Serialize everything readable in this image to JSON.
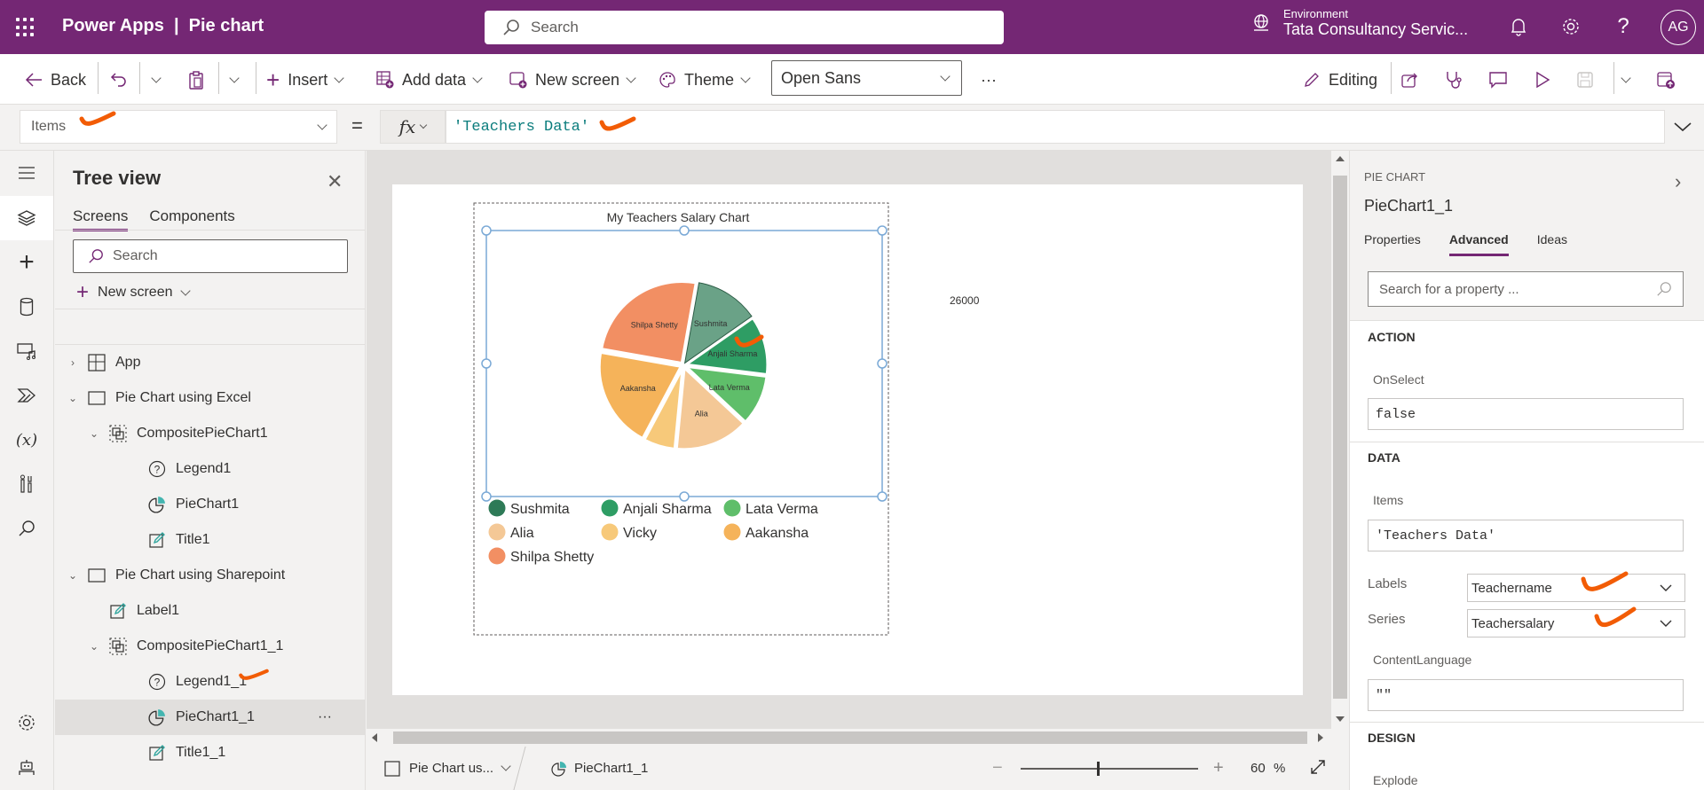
{
  "header": {
    "app_title": "Power Apps  |  Pie chart",
    "search_placeholder": "Search",
    "environment_label": "Environment",
    "environment_name": "Tata Consultancy Servic...",
    "avatar_initials": "AG"
  },
  "toolbar": {
    "back": "Back",
    "insert": "Insert",
    "add_data": "Add data",
    "new_screen": "New screen",
    "theme": "Theme",
    "font": "Open Sans",
    "more": "···",
    "editing": "Editing"
  },
  "formula_bar": {
    "property": "Items",
    "equals": "=",
    "fx": "fx",
    "formula": "'Teachers Data'"
  },
  "tree_view": {
    "title": "Tree view",
    "tabs": [
      "Screens",
      "Components"
    ],
    "search_placeholder": "Search",
    "new_screen": "New screen",
    "rows": [
      {
        "label": "App",
        "indent": 0,
        "icon": "app-icon",
        "arrow": "›"
      },
      {
        "label": "Pie Chart using Excel",
        "indent": 0,
        "icon": "screen-icon",
        "arrow": "⌄"
      },
      {
        "label": "CompositePieChart1",
        "indent": 1,
        "icon": "group-icon",
        "arrow": "⌄"
      },
      {
        "label": "Legend1",
        "indent": 2,
        "icon": "legend-icon",
        "arrow": ""
      },
      {
        "label": "PieChart1",
        "indent": 2,
        "icon": "piechart-icon",
        "arrow": ""
      },
      {
        "label": "Title1",
        "indent": 2,
        "icon": "label-icon",
        "arrow": ""
      },
      {
        "label": "Pie Chart using Sharepoint",
        "indent": 0,
        "icon": "screen-icon",
        "arrow": "⌄"
      },
      {
        "label": "Label1",
        "indent": 1,
        "icon": "label-icon",
        "arrow": ""
      },
      {
        "label": "CompositePieChart1_1",
        "indent": 1,
        "icon": "group-icon",
        "arrow": "⌄"
      },
      {
        "label": "Legend1_1",
        "indent": 2,
        "icon": "legend-icon",
        "arrow": ""
      },
      {
        "label": "PieChart1_1",
        "indent": 2,
        "icon": "piechart-icon",
        "arrow": "",
        "selected": true
      },
      {
        "label": "Title1_1",
        "indent": 2,
        "icon": "label-icon",
        "arrow": ""
      }
    ],
    "row_more": "···"
  },
  "canvas": {
    "floating_value": "26000"
  },
  "chart_data": {
    "type": "pie",
    "title": "My Teachers Salary Chart",
    "categories": [
      "Sushmita",
      "Anjali Sharma",
      "Lata Verma",
      "Alia",
      "Vicky",
      "Aakansha",
      "Shilpa Shetty"
    ],
    "values": [
      30000,
      28000,
      24000,
      35000,
      15000,
      48000,
      60000
    ],
    "colors": [
      "#6aa287",
      "#2e9d64",
      "#5fbe6a",
      "#f4c896",
      "#f7c97a",
      "#f5b35a",
      "#f28f63"
    ],
    "legend_colors": [
      "#2e7a57",
      "#2e9d64",
      "#5fbe6a",
      "#f4c896",
      "#f7c97a",
      "#f5b35a",
      "#f28f63"
    ],
    "slice_labels": [
      "Sushmita",
      "Anjali Sharma",
      "Lata Verma",
      "Alia",
      "",
      "Aakansha",
      "Shilpa Shetty"
    ],
    "legend_position": "bottom",
    "start_angle_deg": 10,
    "explode": true
  },
  "status_bar": {
    "screen": "Pie Chart us...",
    "control": "PieChart1_1",
    "zoom_minus": "−",
    "zoom_plus": "+",
    "zoom_value": "60",
    "zoom_unit": "%",
    "zoom_level": 0.6
  },
  "properties": {
    "kind": "PIE CHART",
    "name": "PieChart1_1",
    "tabs": [
      "Properties",
      "Advanced",
      "Ideas"
    ],
    "search_placeholder": "Search for a property ...",
    "action_header": "ACTION",
    "onselect_label": "OnSelect",
    "onselect_value": "false",
    "data_header": "DATA",
    "items_label": "Items",
    "items_value": "'Teachers Data'",
    "labels_label": "Labels",
    "labels_value": "Teachername",
    "series_label": "Series",
    "series_value": "Teachersalary",
    "contentlanguage_label": "ContentLanguage",
    "contentlanguage_value": "\"\"",
    "design_header": "DESIGN",
    "explode_label": "Explode"
  },
  "colors": {
    "brand": "#742774",
    "annotation": "#f25c05"
  }
}
